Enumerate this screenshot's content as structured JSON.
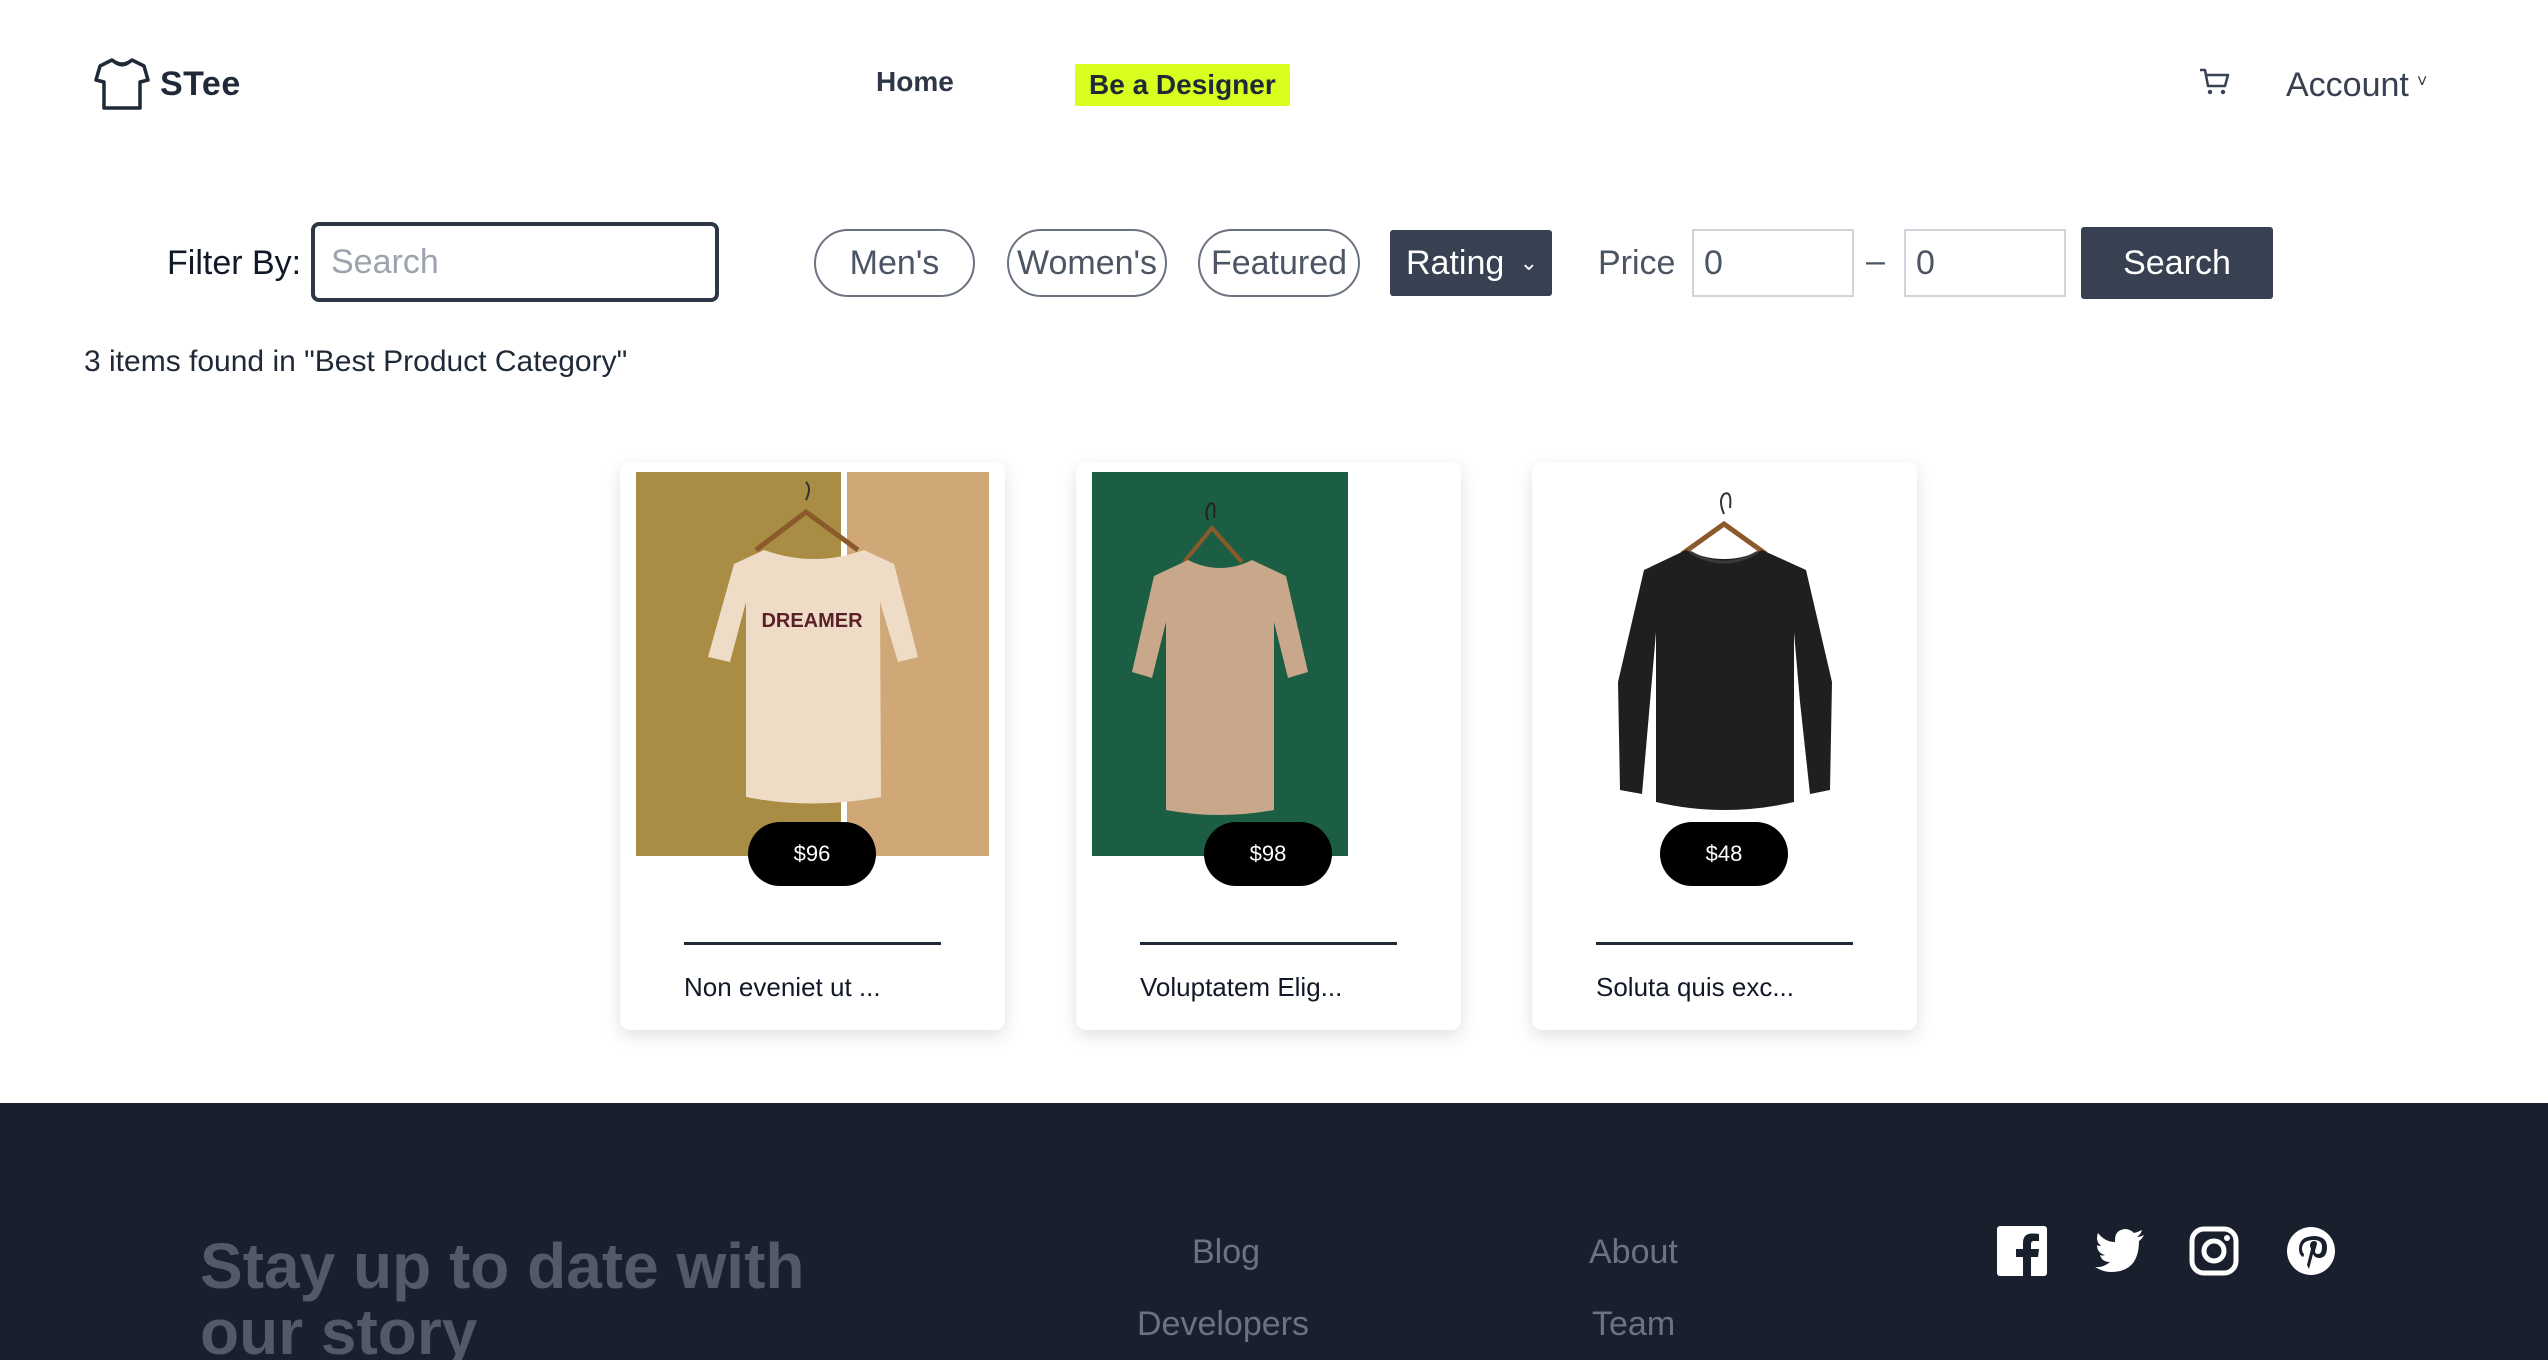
{
  "header": {
    "brand": "STee",
    "nav": {
      "home": "Home",
      "designer": "Be a Designer"
    },
    "account": "Account",
    "icons": {
      "logo": "tshirt-icon",
      "cart": "cart-icon",
      "account_chevron": "chevron-down-icon"
    }
  },
  "filters": {
    "label": "Filter By:",
    "search_placeholder": "Search",
    "chips": [
      "Men's",
      "Women's",
      "Featured"
    ],
    "sort": "Rating",
    "price_label": "Price",
    "price_min": "0",
    "price_dash": "–",
    "price_max": "0",
    "search_button": "Search"
  },
  "results": {
    "summary": "3 items found in \"Best Product Category\""
  },
  "products": [
    {
      "price": "$96",
      "title": "Non eveniet ut ..."
    },
    {
      "price": "$98",
      "title": "Voluptatem Elig..."
    },
    {
      "price": "$48",
      "title": "Soluta quis exc..."
    }
  ],
  "footer": {
    "tagline": "Stay up to date with our story",
    "links": {
      "blog": "Blog",
      "developers": "Developers",
      "about": "About",
      "team": "Team"
    },
    "social": [
      "facebook-icon",
      "twitter-icon",
      "instagram-icon",
      "pinterest-icon"
    ]
  },
  "colors": {
    "accent": "#d9ff1f",
    "primary_dark": "#374151",
    "footer_bg": "#1a1f2e"
  }
}
